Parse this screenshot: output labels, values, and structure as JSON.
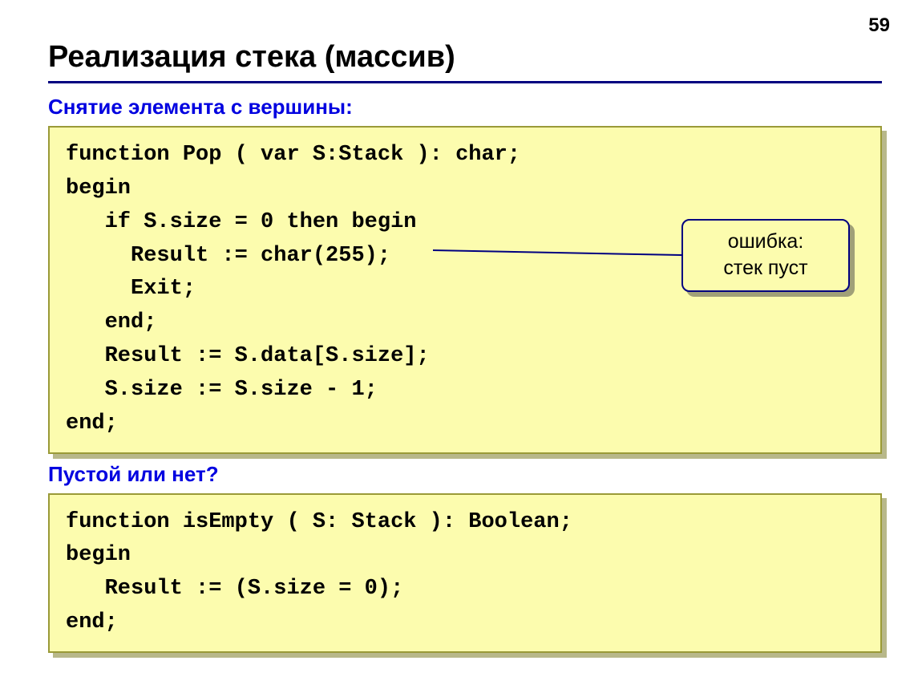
{
  "page_number": "59",
  "title": "Реализация стека (массив)",
  "subhead1": "Снятие элемента с вершины:",
  "code1": "function Pop ( var S:Stack ): char;\nbegin\n   if S.size = 0 then begin\n     Result := char(255);\n     Exit;\n   end;\n   Result := S.data[S.size];\n   S.size := S.size - 1;\nend;",
  "callout_line1": "ошибка:",
  "callout_line2": "стек пуст",
  "subhead2": "Пустой или нет?",
  "code2": "function isEmpty ( S: Stack ): Boolean;\nbegin\n   Result := (S.size = 0);\nend;"
}
